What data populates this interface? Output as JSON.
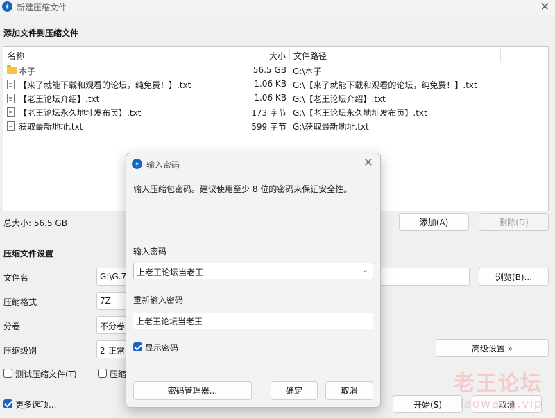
{
  "window": {
    "title": "新建压缩文件"
  },
  "add_section": {
    "title": "添加文件到压缩文件"
  },
  "file_table": {
    "headers": {
      "name": "名称",
      "size": "大小",
      "path": "文件路径"
    },
    "rows": [
      {
        "icon": "folder-icon",
        "name": "本子",
        "size": "56.5 GB",
        "path": "G:\\本子"
      },
      {
        "icon": "text-file-icon",
        "name": "【来了就能下载和观看的论坛，纯免费！】.txt",
        "size": "1.06 KB",
        "path": "G:\\【来了就能下载和观看的论坛，纯免费！】.txt"
      },
      {
        "icon": "text-file-icon",
        "name": "【老王论坛介绍】.txt",
        "size": "1.06 KB",
        "path": "G:\\【老王论坛介绍】.txt"
      },
      {
        "icon": "text-file-icon",
        "name": "【老王论坛永久地址发布页】.txt",
        "size": "173 字节",
        "path": "G:\\【老王论坛永久地址发布页】.txt"
      },
      {
        "icon": "text-file-icon",
        "name": "获取最新地址.txt",
        "size": "599 字节",
        "path": "G:\\获取最新地址.txt"
      }
    ]
  },
  "total_size": "总大小: 56.5 GB",
  "buttons": {
    "add": "添加(A)",
    "delete": "删除(D)",
    "browse": "浏览(B)...",
    "advanced": "高级设置 »",
    "start": "开始(S)",
    "cancel": "取消"
  },
  "settings": {
    "title": "压缩文件设置",
    "filename_label": "文件名",
    "filename_value": "G:\\G.7.",
    "format_label": "压缩格式",
    "format_value": "7Z",
    "split_label": "分卷",
    "split_value": "不分卷",
    "level_label": "压缩级别",
    "level_value": "2-正常",
    "test_label": "测试压缩文件(T)",
    "test_checked": false,
    "second_label": "压缩",
    "second_checked": false,
    "more_label": "更多选项...",
    "more_checked": true
  },
  "password_dialog": {
    "title": "输入密码",
    "message": "输入压缩包密码。建议使用至少 8 位的密码来保证安全性。",
    "password_label": "输入密码",
    "password_value": "上老王论坛当老王",
    "reenter_label": "重新输入密码",
    "reenter_value": "上老王论坛当老王",
    "show_password_label": "显示密码",
    "show_password_checked": true,
    "manager_button": "密码管理器...",
    "ok_button": "确定",
    "cancel_button": "取消"
  },
  "watermark": {
    "line1": "老王论坛",
    "line2": "laowang.vip"
  }
}
